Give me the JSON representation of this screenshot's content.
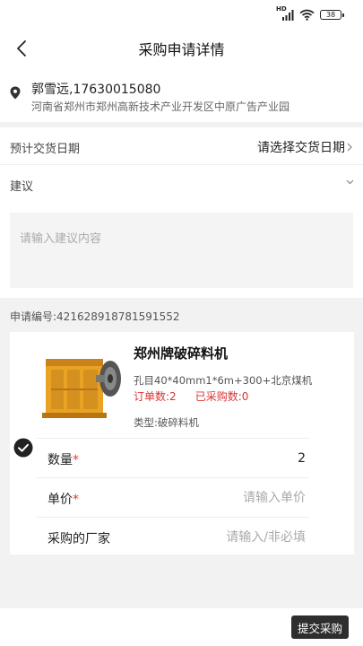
{
  "status_bar": {
    "hd_label": "HD",
    "battery": "38"
  },
  "nav": {
    "title": "采购申请详情"
  },
  "address": {
    "contact": "郭雪远,17630015080",
    "full_address": "河南省郑州市郑州高新技术产业开发区中原广告产业园"
  },
  "form": {
    "delivery_label": "预计交货日期",
    "delivery_value": "请选择交货日期",
    "suggest_label": "建议",
    "suggest_placeholder": "请输入建议内容"
  },
  "application": {
    "number_text": "申请编号:421628918781591552"
  },
  "product": {
    "name": "郑州牌破碎料机",
    "spec": "孔目40*40mm1*6m+300+北京煤机",
    "order_count": "订单数:2",
    "purchased_count": "已采购数:0",
    "type": "类型:破碎料机",
    "quantity_label": "数量",
    "quantity_value": "2",
    "price_label": "单价",
    "price_placeholder": "请输入单价",
    "vendor_label": "采购的厂家",
    "vendor_placeholder": "请输入/非必填",
    "required_mark": "*"
  },
  "footer": {
    "submit_label": "提交采购"
  },
  "colors": {
    "accent_dark": "#2e2e2e",
    "warning_red": "#d33",
    "machine_orange": "#e9a224"
  },
  "icons": [
    "back-arrow-icon",
    "location-pin-icon",
    "chevron-right-icon",
    "chevron-down-icon",
    "check-circle-icon",
    "signal-icon",
    "wifi-icon",
    "battery-icon"
  ]
}
